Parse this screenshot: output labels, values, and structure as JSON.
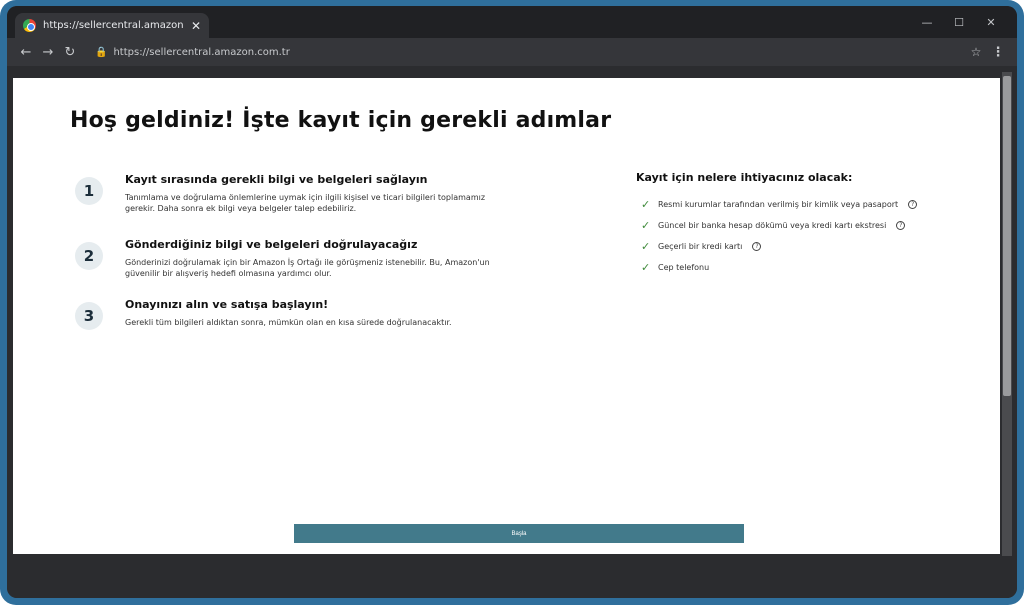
{
  "browser": {
    "tab_title": "https://sellercentral.amazon.com.tr",
    "url": "https://sellercentral.amazon.com.tr"
  },
  "page": {
    "title": "Hoş geldiniz! İşte kayıt için gerekli adımlar",
    "steps": [
      {
        "number": "1",
        "title": "Kayıt sırasında gerekli bilgi ve belgeleri sağlayın",
        "description": "Tanımlama ve doğrulama önlemlerine uymak için ilgili kişisel ve ticari bilgileri toplamamız gerekir. Daha sonra ek bilgi veya belgeler talep edebiliriz."
      },
      {
        "number": "2",
        "title": "Gönderdiğiniz bilgi ve belgeleri doğrulayacağız",
        "description": "Gönderinizi doğrulamak için bir Amazon İş Ortağı ile görüşmeniz istenebilir. Bu, Amazon'un güvenilir bir alışveriş hedefi olmasına yardımcı olur."
      },
      {
        "number": "3",
        "title": "Onayınızı alın ve satışa başlayın!",
        "description": "Gerekli tüm bilgileri aldıktan sonra, mümkün olan en kısa sürede doğrulanacaktır."
      }
    ],
    "requirements_heading": "Kayıt için nelere ihtiyacınız olacak:",
    "requirements": [
      {
        "label": "Resmi kurumlar tarafından verilmiş bir kimlik veya pasaport",
        "help": true
      },
      {
        "label": "Güncel bir banka hesap dökümü veya kredi kartı ekstresi",
        "help": true
      },
      {
        "label": "Geçerli bir kredi kartı",
        "help": true
      },
      {
        "label": "Cep telefonu",
        "help": false
      }
    ],
    "start_button": "Başla"
  }
}
